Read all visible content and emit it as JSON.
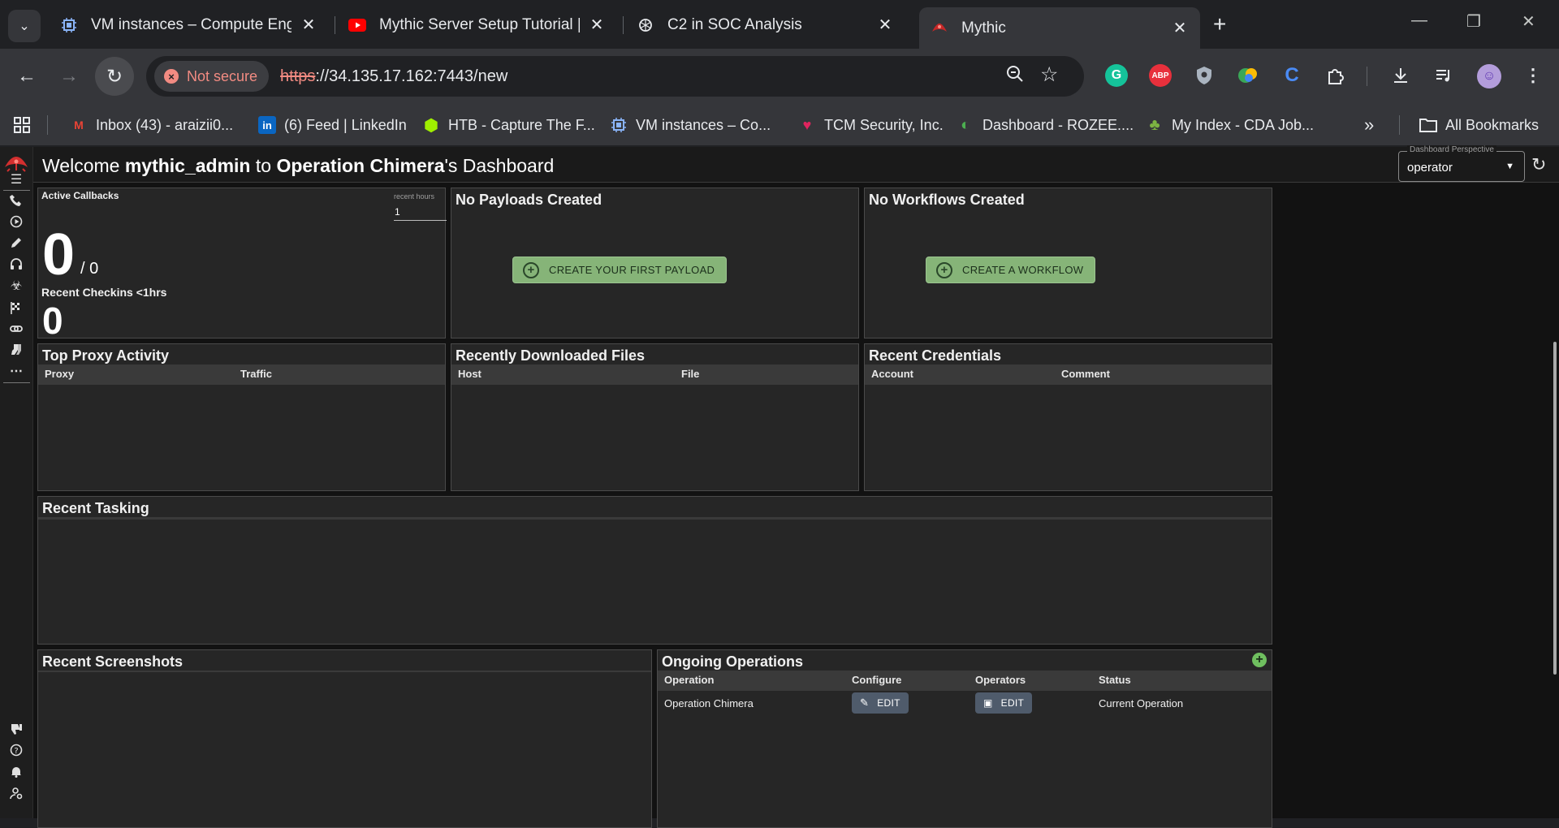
{
  "browser": {
    "tabs": [
      {
        "title": "VM instances – Compute Engine",
        "icon": "compute-engine-icon"
      },
      {
        "title": "Mythic Server Setup Tutorial | D",
        "icon": "youtube-icon"
      },
      {
        "title": "C2 in SOC Analysis",
        "icon": "chatgpt-icon"
      },
      {
        "title": "Mythic",
        "icon": "mythic-icon",
        "active": true
      }
    ],
    "security_label": "Not secure",
    "url_scheme": "https",
    "url_rest": "://34.135.17.162:7443/new",
    "extensions": [
      {
        "name": "grammarly-icon",
        "label": "G",
        "color": "#15c39a"
      },
      {
        "name": "adblock-plus-icon",
        "label": "ABP",
        "color": "#e8303c"
      },
      {
        "name": "shield-extension-icon",
        "label": "",
        "color": "#aab4c0"
      },
      {
        "name": "translate-extension-icon",
        "label": "",
        "color": "#3aa757"
      },
      {
        "name": "c-extension-icon",
        "label": "C",
        "color": "#4a8bf5"
      }
    ],
    "bookmarks": [
      {
        "label": "Inbox (43) - araizii0...",
        "icon": "gmail-icon",
        "glyph": "M",
        "color": "#ea4335"
      },
      {
        "label": "(6) Feed | LinkedIn",
        "icon": "linkedin-icon",
        "glyph": "in",
        "color": "#0a66c2"
      },
      {
        "label": "HTB - Capture The F...",
        "icon": "htb-icon",
        "glyph": "⬢",
        "color": "#9fef00"
      },
      {
        "label": "VM instances – Co...",
        "icon": "compute-engine-icon",
        "glyph": "▣",
        "color": "#8ab4f8"
      },
      {
        "label": "TCM Security, Inc.",
        "icon": "tcm-icon",
        "glyph": "♥",
        "color": "#e0245e"
      },
      {
        "label": "Dashboard - ROZEE....",
        "icon": "rozee-icon",
        "glyph": "◐",
        "color": "#4caf50"
      },
      {
        "label": "My Index - CDA Job...",
        "icon": "cda-icon",
        "glyph": "♣",
        "color": "#7cb342"
      }
    ],
    "more_bookmarks": "»",
    "all_bookmarks": "All Bookmarks"
  },
  "app": {
    "welcome_prefix": "Welcome ",
    "username": "mythic_admin",
    "welcome_mid": " to ",
    "operation_name": "Operation Chimera",
    "welcome_suffix": "'s Dashboard",
    "perspective_label": "Dashboard Perspective",
    "perspective_value": "operator",
    "active_callbacks": {
      "title": "Active Callbacks",
      "recent_hours_label": "recent hours",
      "recent_hours_value": "1",
      "count": "0",
      "total": "/ 0",
      "checkins_label": "Recent Checkins <1hrs",
      "checkins_count": "0"
    },
    "payloads": {
      "title": "No Payloads Created",
      "button": "CREATE YOUR FIRST PAYLOAD"
    },
    "workflows": {
      "title": "No Workflows Created",
      "button": "CREATE A WORKFLOW"
    },
    "proxy": {
      "title": "Top Proxy Activity",
      "columns": [
        "Proxy",
        "Traffic"
      ]
    },
    "downloads": {
      "title": "Recently Downloaded Files",
      "columns": [
        "Host",
        "File"
      ]
    },
    "credentials": {
      "title": "Recent Credentials",
      "columns": [
        "Account",
        "Comment"
      ]
    },
    "tasking": {
      "title": "Recent Tasking"
    },
    "screenshots": {
      "title": "Recent Screenshots"
    },
    "operations": {
      "title": "Ongoing Operations",
      "columns": [
        "Operation",
        "Configure",
        "Operators",
        "Status"
      ],
      "rows": [
        {
          "operation": "Operation Chimera",
          "configure": "EDIT",
          "operators": "EDIT",
          "status": "Current Operation"
        }
      ]
    }
  }
}
